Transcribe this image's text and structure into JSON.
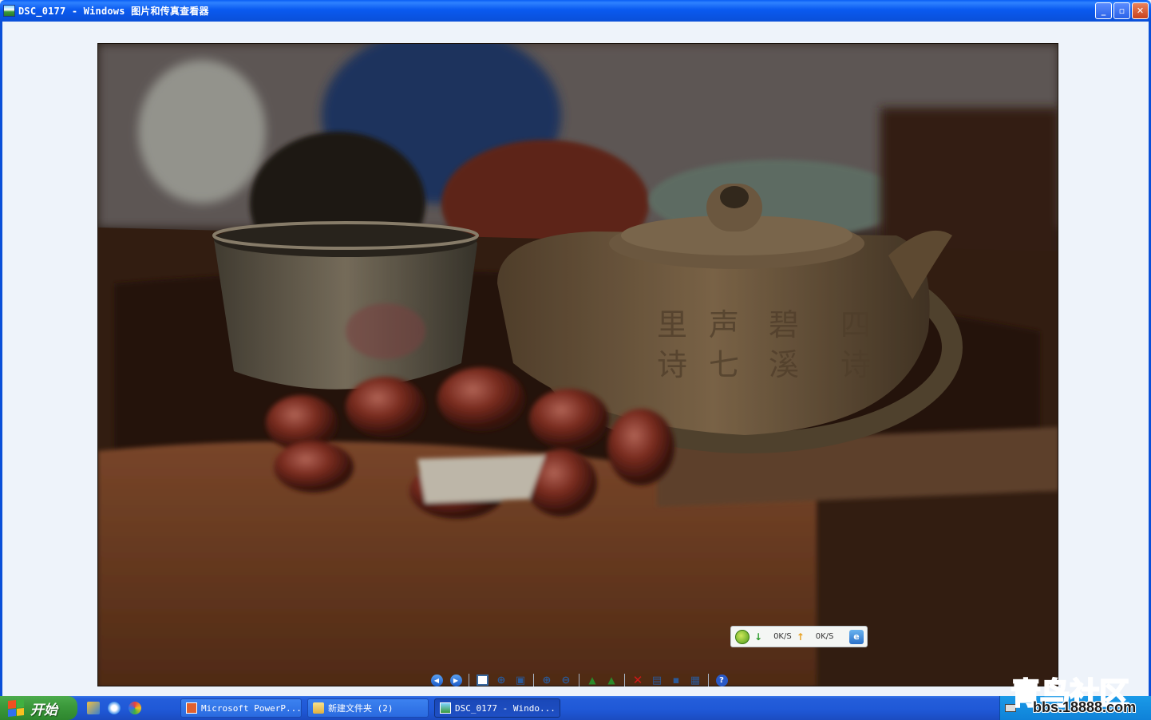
{
  "window": {
    "title": "DSC_0177 - Windows 图片和传真查看器",
    "minimize": "_",
    "restore": "▫",
    "close": "✕"
  },
  "download_widget": {
    "down_speed": "0K/S",
    "up_speed": "0K/S"
  },
  "toolbar": {
    "buttons": [
      {
        "name": "previous-image",
        "icon": "previous-icon"
      },
      {
        "name": "next-image",
        "icon": "next-icon"
      },
      {
        "name": "best-fit",
        "icon": "best-fit-icon"
      },
      {
        "name": "actual-size",
        "icon": "actual-size-icon"
      },
      {
        "name": "slideshow",
        "icon": "slideshow-icon"
      },
      {
        "name": "zoom-in",
        "icon": "zoom-in-icon"
      },
      {
        "name": "zoom-out",
        "icon": "zoom-out-icon"
      },
      {
        "name": "rotate-clockwise",
        "icon": "rotate-cw-icon"
      },
      {
        "name": "rotate-counterclockwise",
        "icon": "rotate-ccw-icon"
      },
      {
        "name": "delete",
        "icon": "delete-icon"
      },
      {
        "name": "print",
        "icon": "print-icon"
      },
      {
        "name": "save",
        "icon": "save-icon"
      },
      {
        "name": "edit",
        "icon": "edit-icon"
      },
      {
        "name": "help",
        "icon": "help-icon"
      }
    ]
  },
  "taskbar": {
    "start_label": "开始",
    "tasks": [
      {
        "label": "Microsoft PowerP..."
      },
      {
        "label": "新建文件夹 (2)"
      },
      {
        "label": "DSC_0177 - Windo..."
      }
    ]
  },
  "watermark": {
    "big": "青鸟社区",
    "url": "bbs.18888.com"
  },
  "photo": {
    "teapot_inscription": [
      "四",
      "碧",
      "声",
      "里",
      "诗",
      "溪",
      "七",
      "诗"
    ]
  }
}
